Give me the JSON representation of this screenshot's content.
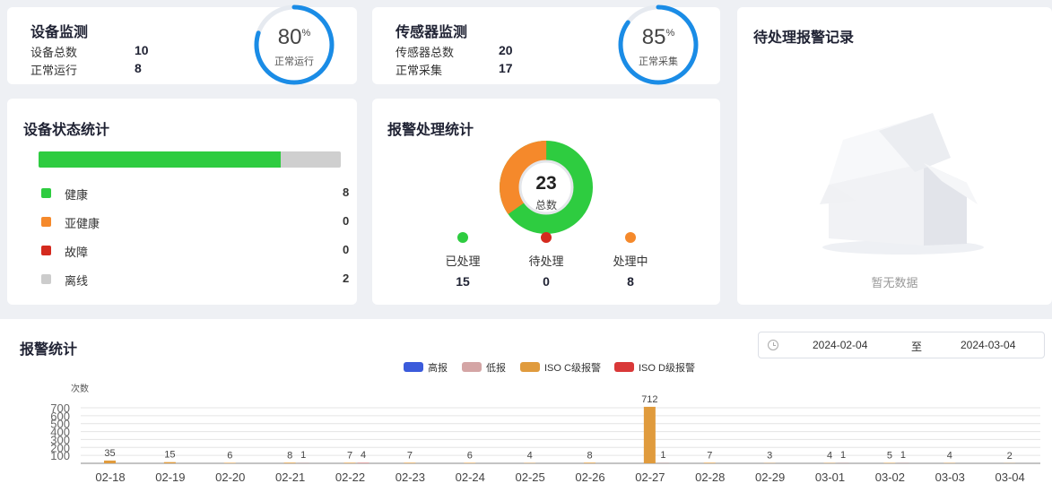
{
  "device": {
    "title": "设备监测",
    "total_label": "设备总数",
    "total_value": "10",
    "running_label": "正常运行",
    "running_value": "8",
    "ring_percent": "80",
    "ring_percent_unit": "%",
    "ring_fraction": 0.8,
    "ring_label": "正常运行"
  },
  "sensor": {
    "title": "传感器监测",
    "total_label": "传感器总数",
    "total_value": "20",
    "collect_label": "正常采集",
    "collect_value": "17",
    "ring_percent": "85",
    "ring_percent_unit": "%",
    "ring_fraction": 0.85,
    "ring_label": "正常采集"
  },
  "pending_alarms": {
    "title": "待处理报警记录",
    "empty_text": "暂无数据"
  },
  "device_status": {
    "title": "设备状态统计",
    "bar_healthy_fraction": 0.8,
    "items": [
      {
        "label": "健康",
        "value": "8",
        "color": "#2ecc40"
      },
      {
        "label": "亚健康",
        "value": "0",
        "color": "#f5892b"
      },
      {
        "label": "故障",
        "value": "0",
        "color": "#d42a1e"
      },
      {
        "label": "离线",
        "value": "2",
        "color": "#cccccc"
      }
    ]
  },
  "alarm_handling": {
    "title": "报警处理统计",
    "total_value": "23",
    "total_label": "总数",
    "items": [
      {
        "label": "已处理",
        "value": "15",
        "color": "#2ecc40"
      },
      {
        "label": "待处理",
        "value": "0",
        "color": "#d42a1e"
      },
      {
        "label": "处理中",
        "value": "8",
        "color": "#f5892b"
      }
    ]
  },
  "alarm_stats": {
    "title": "报警统计",
    "date_from": "2024-02-04",
    "date_sep": "至",
    "date_to": "2024-03-04",
    "colors": {
      "high": "#3b5bdb",
      "low": "#d4a5a5",
      "iso_c": "#e09b3d",
      "iso_d": "#d93838"
    }
  },
  "chart_data": {
    "type": "bar",
    "ylabel": "次数",
    "yticks": [
      "700",
      "600",
      "500",
      "400",
      "300",
      "200",
      "100"
    ],
    "ylim": [
      0,
      700
    ],
    "categories": [
      "02-18",
      "02-19",
      "02-20",
      "02-21",
      "02-22",
      "02-23",
      "02-24",
      "02-25",
      "02-26",
      "02-27",
      "02-28",
      "02-29",
      "03-01",
      "03-02",
      "03-03",
      "03-04"
    ],
    "series": [
      {
        "name": "高报",
        "color": "#3b5bdb",
        "values": [
          0,
          0,
          0,
          0,
          0,
          0,
          0,
          0,
          0,
          0,
          0,
          0,
          0,
          0,
          0,
          0
        ]
      },
      {
        "name": "低报",
        "color": "#d4a5a5",
        "values": [
          0,
          0,
          0,
          0,
          0,
          0,
          0,
          0,
          0,
          0,
          0,
          0,
          0,
          0,
          0,
          0
        ]
      },
      {
        "name": "ISO C级报警",
        "color": "#e09b3d",
        "values": [
          35,
          15,
          6,
          8,
          7,
          7,
          6,
          4,
          8,
          712,
          7,
          3,
          4,
          5,
          4,
          2
        ]
      },
      {
        "name": "ISO D级报警",
        "color": "#d93838",
        "values": [
          null,
          null,
          null,
          1,
          4,
          null,
          null,
          null,
          null,
          1,
          null,
          null,
          1,
          1,
          null,
          null
        ]
      }
    ]
  }
}
